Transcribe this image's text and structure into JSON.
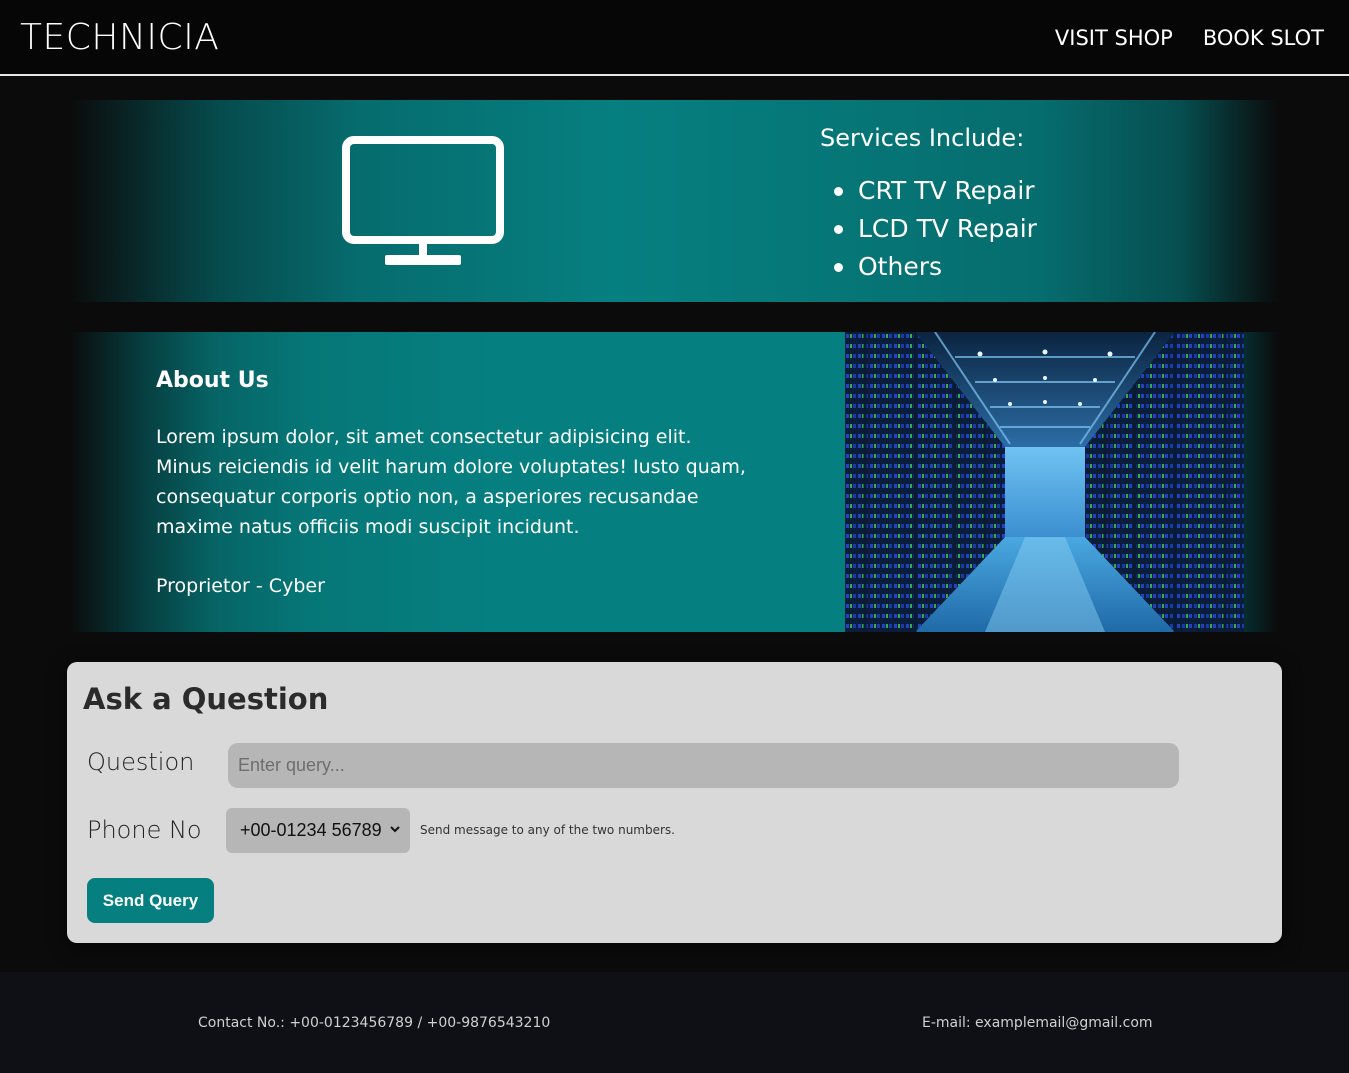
{
  "header": {
    "brand": "TECHNICIA",
    "nav": {
      "visit_shop": "VISIT SHOP",
      "book_slot": "BOOK SLOT"
    }
  },
  "services": {
    "icon": "monitor-icon",
    "title": "Services Include:",
    "items": [
      "CRT TV Repair",
      "LCD TV Repair",
      "Others"
    ]
  },
  "about": {
    "title": "About Us",
    "text": "Lorem ipsum dolor, sit amet consectetur adipisicing elit. Minus reiciendis id velit harum dolore voluptates! Iusto quam, consequatur corporis optio non, a asperiores recusandae maxime natus officiis modi suscipit incidunt.",
    "signature": "Proprietor - Cyber",
    "image": "server-room-image"
  },
  "question_form": {
    "title": "Ask a Question",
    "question_label": "Question",
    "question_placeholder": "Enter query...",
    "question_value": "",
    "phone_label": "Phone No",
    "phone_selected": "+00-01234 56789",
    "phone_hint": "Send message to any of the two numbers.",
    "send_label": "Send Query"
  },
  "footer": {
    "contact": "Contact No.: +00-0123456789 / +00-9876543210",
    "email": "E-mail: examplemail@gmail.com"
  },
  "colors": {
    "accent": "#067f80",
    "background": "#0b0b0b",
    "card": "#d9d9d9",
    "footer": "#0f0f16"
  }
}
